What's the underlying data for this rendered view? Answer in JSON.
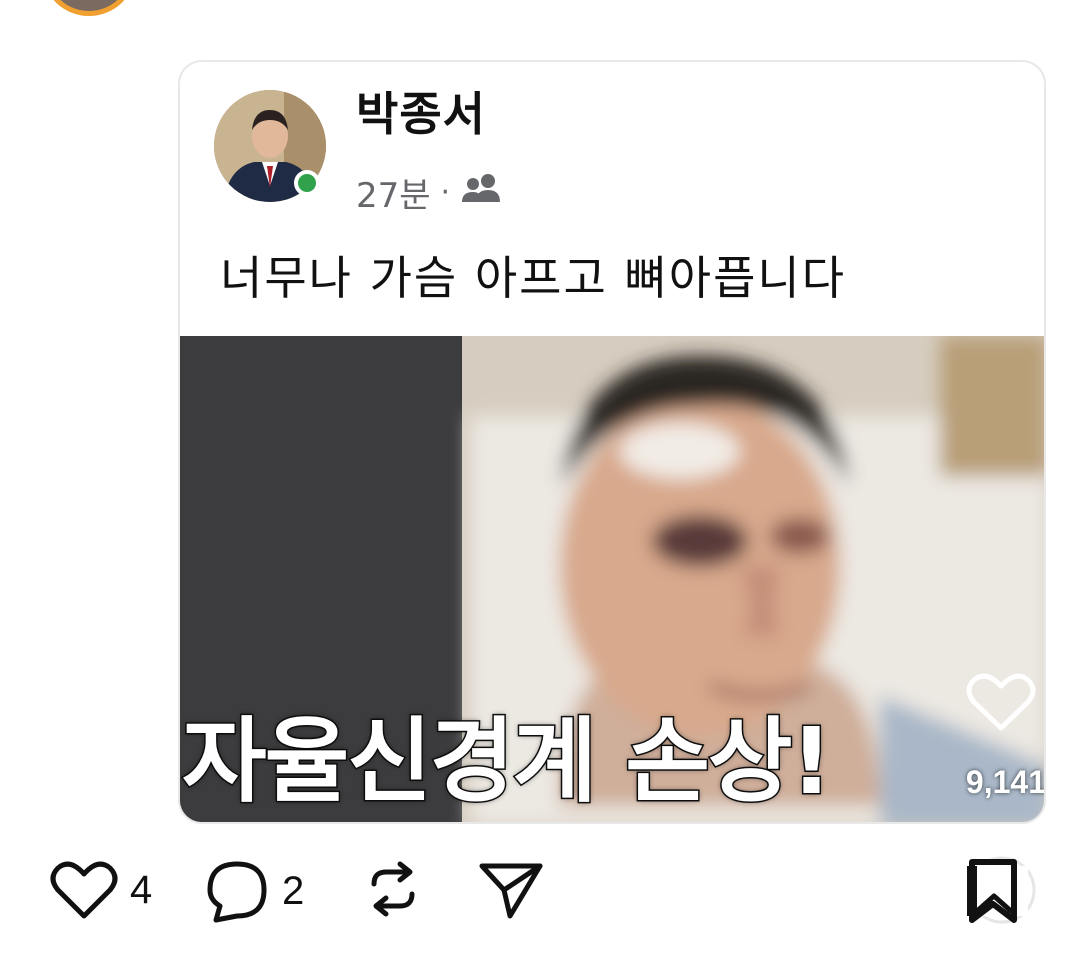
{
  "post": {
    "author_name": "박종서",
    "time": "27분",
    "separator": "·",
    "audience_icon": "friends-icon",
    "text": "너무나 가슴 아프고 뼈아픕니다",
    "image_caption": "자율신경계 손상!",
    "image_like_count": "9,141"
  },
  "actions": {
    "like_count": "4",
    "comment_count": "2",
    "like_icon": "heart-icon",
    "comment_icon": "comment-icon",
    "repost_icon": "repost-icon",
    "share_icon": "send-icon",
    "save_icon": "bookmark-icon"
  },
  "colors": {
    "online_green": "#31a24c",
    "avatar_ring": "#f0a030",
    "meta_gray": "#65676b"
  }
}
